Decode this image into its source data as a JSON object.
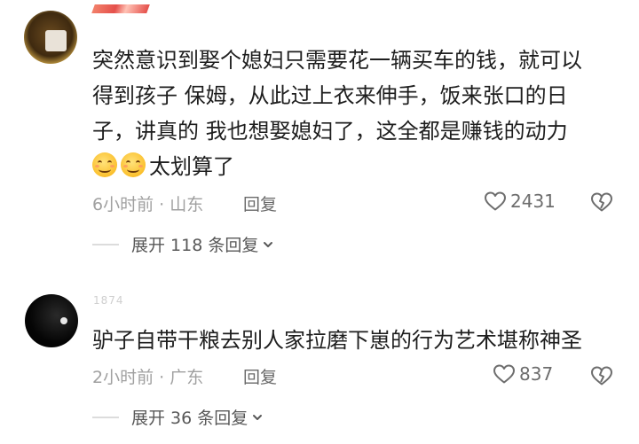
{
  "comments": [
    {
      "username": "",
      "text_lines": [
        "突然意识到娶个媳妇只需要花一辆买车的钱，就可以",
        "得到孩子 保姆，从此过上衣来伸手，饭来张口的日",
        "子，讲真的 我也想娶媳妇了，这全都是赚钱的动力"
      ],
      "emoji_count": 2,
      "emoji_name": "smile-emoji",
      "tail_text": "太划算了",
      "meta": "6小时前 · 山东",
      "reply_label": "回复",
      "likes": "2431",
      "expand_label": "展开 118 条回复"
    },
    {
      "username": "1874",
      "text_lines": [
        "驴子自带干粮去别人家拉磨下崽的行为艺术堪称神圣"
      ],
      "meta": "2小时前 · 广东",
      "reply_label": "回复",
      "likes": "837",
      "expand_label": "展开 36 条回复"
    }
  ],
  "icons": {
    "like": "heart-outline-icon",
    "dislike": "broken-heart-icon",
    "expand": "chevron-down-icon"
  },
  "colors": {
    "text": "#1e1e1e",
    "meta": "#a0a0a0",
    "username_highlight": "#e0312b"
  }
}
